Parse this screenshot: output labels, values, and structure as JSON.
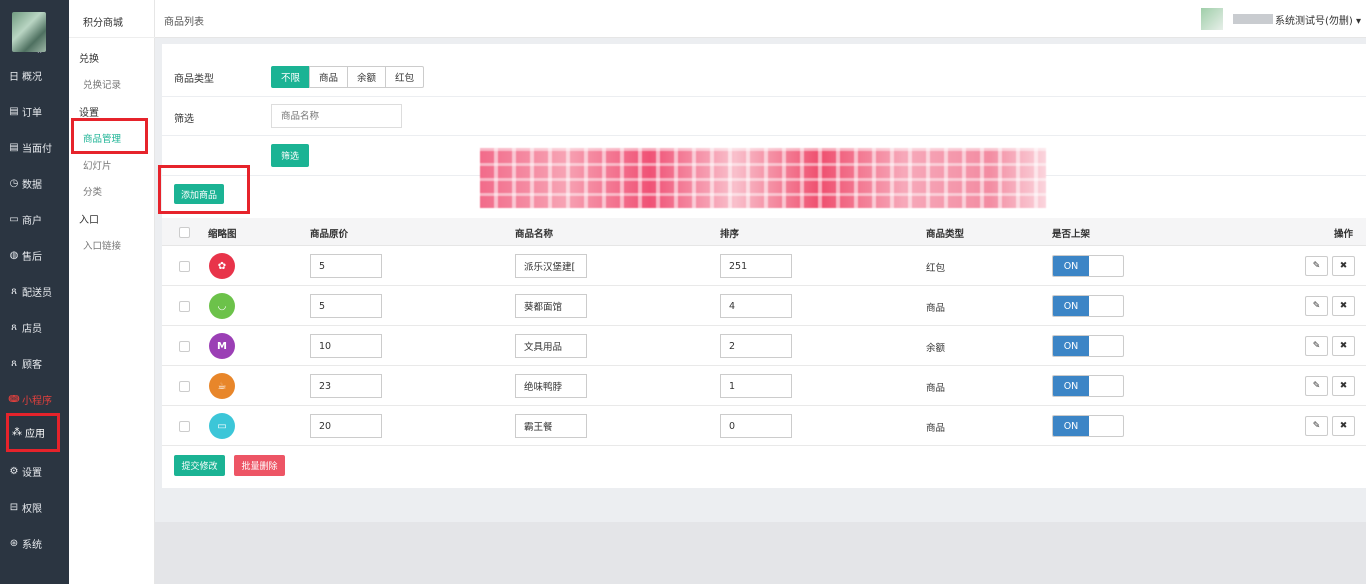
{
  "sidebar": {
    "avatar_dots": "..",
    "items": [
      {
        "icon": "日",
        "label": "概况",
        "name": "overview"
      },
      {
        "icon": "▤",
        "label": "订单",
        "name": "orders"
      },
      {
        "icon": "▤",
        "label": "当面付",
        "name": "face-pay"
      },
      {
        "icon": "◷",
        "label": "数据",
        "name": "data"
      },
      {
        "icon": "▭",
        "label": "商户",
        "name": "merchants"
      },
      {
        "icon": "◍",
        "label": "售后",
        "name": "after-sales"
      },
      {
        "icon": "ጸ",
        "label": "配送员",
        "name": "couriers"
      },
      {
        "icon": "ጸ",
        "label": "店员",
        "name": "clerks"
      },
      {
        "icon": "ጸ",
        "label": "顾客",
        "name": "customers"
      },
      {
        "icon": "ↈ",
        "label": "小程序",
        "name": "mini-program"
      },
      {
        "icon": "⁂",
        "label": "应用",
        "name": "apps"
      },
      {
        "icon": "⚙",
        "label": "设置",
        "name": "settings"
      },
      {
        "icon": "⊟",
        "label": "权限",
        "name": "permissions"
      },
      {
        "icon": "⊛",
        "label": "系统",
        "name": "system"
      }
    ]
  },
  "subnav": {
    "title": "积分商城",
    "group_exchange": "兑换",
    "exchange_records": "兑换记录",
    "group_settings": "设置",
    "product_manage": "商品管理",
    "slides": "幻灯片",
    "categories": "分类",
    "group_entry": "入口",
    "entry_link": "入口链接"
  },
  "topbar": {
    "breadcrumb": "商品列表",
    "user_name": "系统测试号(勿删)",
    "caret": "▾"
  },
  "filters": {
    "type_label": "商品类型",
    "type_options": [
      "不限",
      "商品",
      "余额",
      "红包"
    ],
    "type_selected": "不限",
    "filter_label": "筛选",
    "name_placeholder": "商品名称",
    "filter_button": "筛选",
    "add_button": "添加商品"
  },
  "table": {
    "headers": {
      "thumb": "缩略图",
      "price": "商品原价",
      "name": "商品名称",
      "sort": "排序",
      "type": "商品类型",
      "listed": "是否上架",
      "actions": "操作"
    },
    "rows": [
      {
        "price": "5",
        "name": "派乐汉堡建[",
        "sort": "251",
        "type": "红包",
        "listed": "ON",
        "thumb_color": "#e8344a",
        "thumb_glyph": "✿"
      },
      {
        "price": "5",
        "name": "葵都面馆",
        "sort": "4",
        "type": "商品",
        "listed": "ON",
        "thumb_color": "#6cc24a",
        "thumb_glyph": "◡"
      },
      {
        "price": "10",
        "name": "文具用品",
        "sort": "2",
        "type": "余额",
        "listed": "ON",
        "thumb_color": "#9b3fb5",
        "thumb_glyph": "M"
      },
      {
        "price": "23",
        "name": "绝味鸭脖",
        "sort": "1",
        "type": "商品",
        "listed": "ON",
        "thumb_color": "#e8862a",
        "thumb_glyph": "☕"
      },
      {
        "price": "20",
        "name": "霸王餐",
        "sort": "0",
        "type": "商品",
        "listed": "ON",
        "thumb_color": "#3cc6d8",
        "thumb_glyph": "▭"
      }
    ],
    "edit_icon": "✎",
    "delete_icon": "✖"
  },
  "bulk": {
    "submit": "提交修改",
    "delete": "批量删除"
  },
  "colors": {
    "accent": "#1bb394",
    "danger": "#ed5565",
    "toggle_on": "#3c85c6",
    "sidebar_bg": "#2b3541",
    "highlight_outline": "#e6232b"
  }
}
